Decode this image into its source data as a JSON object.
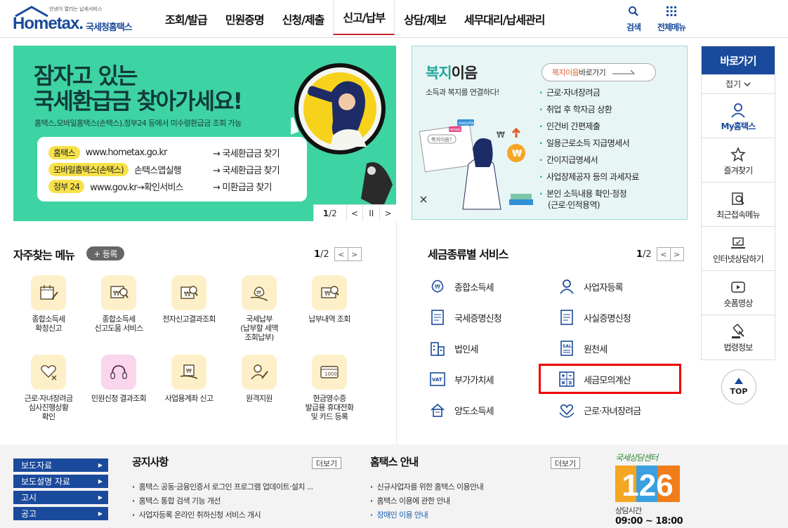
{
  "header": {
    "logo_small": "안녕이 열리는 납세서비스",
    "logo_main": "Hometax.",
    "logo_sub": "국세청홈택스",
    "nav": [
      "조회/발급",
      "민원증명",
      "신청/제출",
      "신고/납부",
      "상담/제보",
      "세무대리/납세관리"
    ],
    "search_label": "검색",
    "all_menu_label": "전체메뉴"
  },
  "banner": {
    "title_line1": "잠자고 있는",
    "title_line2": "국세환급금 찾아가세요!",
    "desc": "홈택스,모바일홈택스(손택스),정부24 등에서 미수령환급금 조회 가능",
    "rows": [
      {
        "chip": "홈택스",
        "site": "www.hometax.go.kr",
        "action": "→ 국세환급금 찾기"
      },
      {
        "chip": "모바일홈택스(손택스)",
        "site": "손택스앱실행",
        "action": "→ 국세환급금 찾기"
      },
      {
        "chip": "정부 24",
        "site": "www.gov.kr→확인서비스",
        "action": "→ 미환급금 찾기"
      }
    ],
    "page_current": "1",
    "page_total": "/2",
    "prev": "<",
    "pause": "II",
    "next": ">"
  },
  "banner2": {
    "title_green": "복지",
    "title_rest": "이음",
    "subtitle": "소득과 복지를 연결하다!",
    "btn_green": "복지이음",
    "btn_rest": " 바로가기",
    "items": [
      "근로·자녀장려금",
      "취업 후 학자금 상환",
      "인건비 간편제출",
      "일용근로소득 지급명세서",
      "간이지급명세서",
      "사업장제공자 등의 과세자료"
    ],
    "item_last_line1": "본인 소득내용 확인·정정",
    "item_last_line2": "(근로·인적용역)",
    "visual_tag1": "복지이음?",
    "visual_tag2": "easyday",
    "visual_tag3": "renew"
  },
  "freq": {
    "title": "자주찾는 메뉴",
    "register": "+ 등록",
    "page_current": "1",
    "page_total": "/2",
    "items": [
      {
        "label": "종합소득세\n확정신고"
      },
      {
        "label": "종합소득세\n신고도움 서비스"
      },
      {
        "label": "전자신고결과조회"
      },
      {
        "label": "국세납부\n(납부할 세액\n조회납부)"
      },
      {
        "label": "납부내역 조회"
      },
      {
        "label": "근로·자녀장려금\n심사진행상황\n확인"
      },
      {
        "label": "민원신청 결과조회"
      },
      {
        "label": "사업용계좌 신고"
      },
      {
        "label": "원격지원"
      },
      {
        "label": "현금영수증\n발급용 휴대전화\n및 카드 등록"
      }
    ]
  },
  "tax": {
    "title": "세금종류별 서비스",
    "page_current": "1",
    "page_total": "/2",
    "items": [
      "종합소득세",
      "사업자등록",
      "국세증명신청",
      "사실증명신청",
      "법인세",
      "원천세",
      "부가가치세",
      "세금모의계산",
      "양도소득세",
      "근로·자녀장려금"
    ]
  },
  "quick": {
    "title": "바로가기",
    "fold": "접기",
    "items": [
      "My홈택스",
      "즐겨찾기",
      "최근접속메뉴",
      "인터넷상담하기",
      "숏폼영상",
      "법령정보"
    ],
    "top": "TOP"
  },
  "footer": {
    "nav": [
      "보도자료",
      "보도설명 자료",
      "고시",
      "공고"
    ],
    "notice_title": "공지사항",
    "notice_more": "더보기",
    "notices": [
      "홈택스 공동·금융인증서 로그인 프로그램 업데이트·설치 ...",
      "홈택스 통합 검색 기능 개선",
      "사업자등록 온라인 취하신청 서비스 개시"
    ],
    "guide_title": "홈택스 안내",
    "guide_more": "더보기",
    "guides": [
      "신규사업자를 위한 홈택스 이용안내",
      "홈택스 이용에 관한 안내",
      "장애인 이용 안내"
    ],
    "cc_script": "국세상담센터",
    "cc_number": "126",
    "cc_hours_label": "상담시간",
    "cc_hours": "09:00 ~ 18:00"
  },
  "colors": {
    "brand": "#1a4a9c",
    "banner_green": "#3ed3a3",
    "highlight": "#ee0000"
  }
}
